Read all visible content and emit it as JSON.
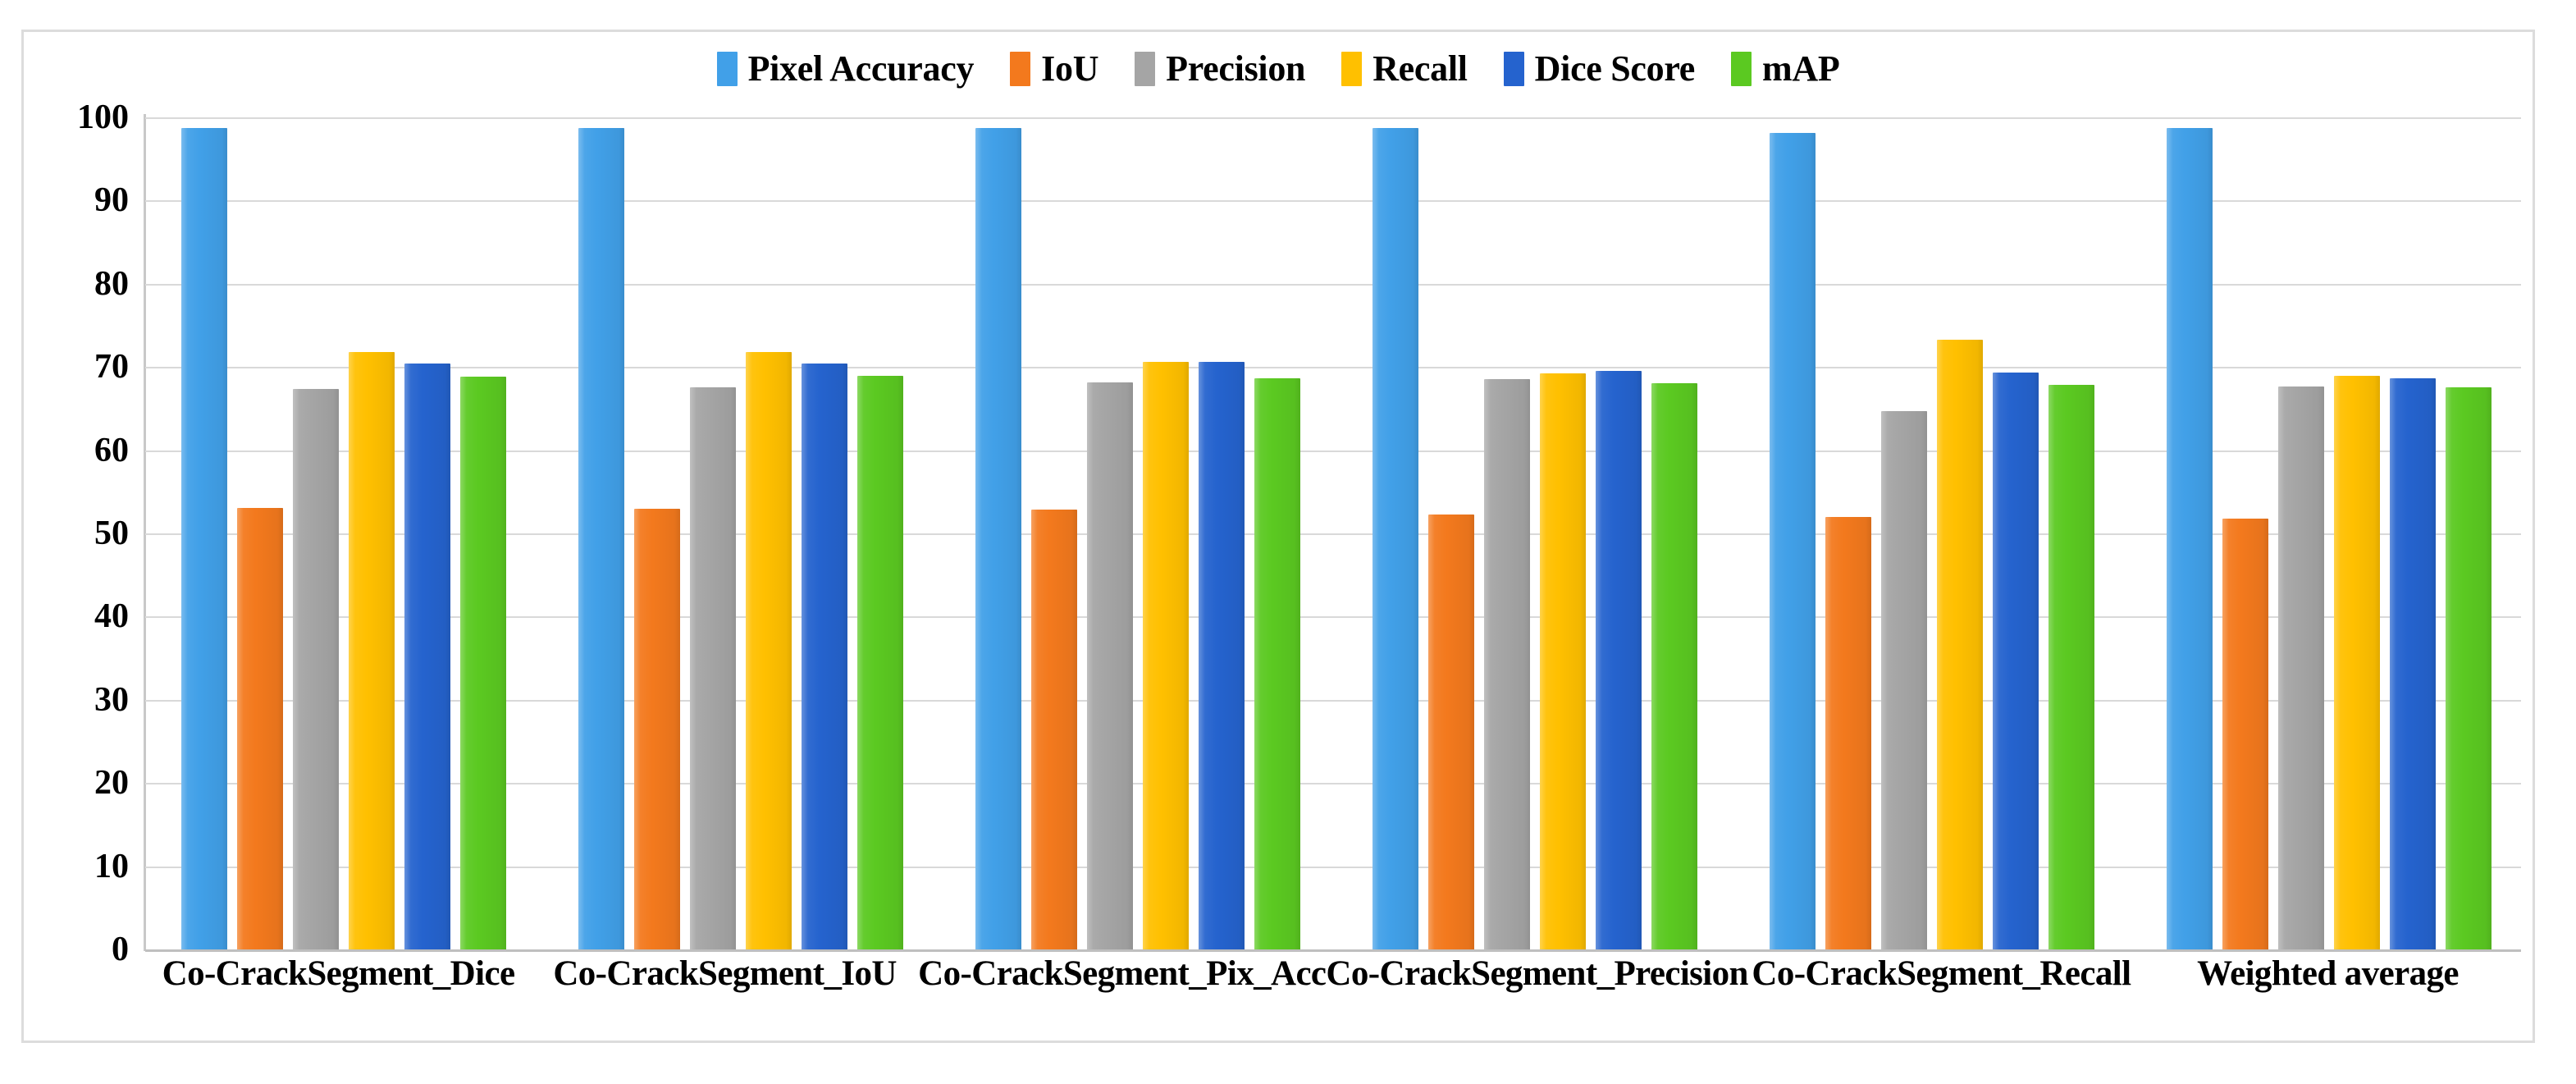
{
  "chart_data": {
    "type": "bar",
    "title": "",
    "subtitle": "",
    "xlabel": "",
    "ylabel": "",
    "ylim": [
      0,
      100
    ],
    "ytick_labels": [
      "100",
      "90",
      "80",
      "70",
      "60",
      "50",
      "40",
      "30",
      "20",
      "10",
      "0"
    ],
    "yticks": [
      100,
      90,
      80,
      70,
      60,
      50,
      40,
      30,
      20,
      10,
      0
    ],
    "grid": true,
    "legend_position": "top-center",
    "categories": [
      "Co-CrackSegment_Dice",
      "Co-CrackSegment_IoU",
      "Co-CrackSegment_Pix_Acc",
      "Co-CrackSegment_Precision",
      "Co-CrackSegment_Recall",
      "Weighted average"
    ],
    "series": [
      {
        "name": "Pixel Accuracy",
        "color": "#41A0E8",
        "values": [
          98.7,
          98.7,
          98.7,
          98.7,
          98.1,
          98.7
        ]
      },
      {
        "name": "IoU",
        "color": "#F3791D",
        "values": [
          53.1,
          53.0,
          52.9,
          52.3,
          52.0,
          51.8
        ]
      },
      {
        "name": "Precision",
        "color": "#A5A5A5",
        "values": [
          67.4,
          67.6,
          68.1,
          68.5,
          64.7,
          67.7
        ]
      },
      {
        "name": "Recall",
        "color": "#FFC000",
        "values": [
          71.8,
          71.8,
          70.6,
          69.2,
          73.3,
          68.9
        ]
      },
      {
        "name": "Dice Score",
        "color": "#2563CE",
        "values": [
          70.4,
          70.4,
          70.6,
          69.5,
          69.3,
          68.6
        ]
      },
      {
        "name": "mAP",
        "color": "#5BC921",
        "values": [
          68.8,
          68.9,
          68.6,
          68.0,
          67.9,
          67.6
        ]
      }
    ]
  }
}
